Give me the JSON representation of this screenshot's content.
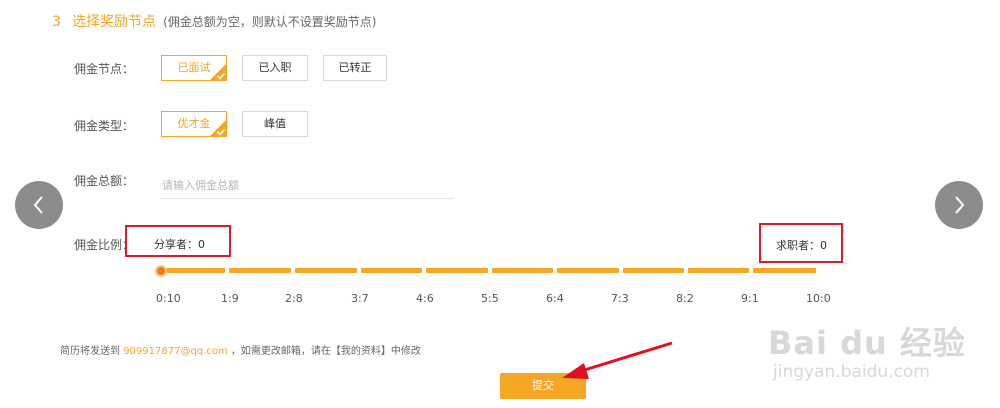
{
  "section": {
    "number": "3",
    "title": "选择奖励节点",
    "note": "(佣金总额为空，则默认不设置奖励节点)"
  },
  "commission_node": {
    "label": "佣金节点：",
    "options": [
      "已面试",
      "已入职",
      "已转正"
    ],
    "selected": "已面试"
  },
  "commission_type": {
    "label": "佣金类型：",
    "options": [
      "优才金",
      "峰值"
    ],
    "selected": "优才金"
  },
  "commission_total": {
    "label": "佣金总额：",
    "placeholder": "请输入佣金总额",
    "value": ""
  },
  "commission_ratio": {
    "label": "佣金比例：",
    "sharer": "分享者：0",
    "seeker": "求职者：0",
    "ticks": [
      "0:10",
      "1:9",
      "2:8",
      "3:7",
      "4:6",
      "5:5",
      "6:4",
      "7:3",
      "8:2",
      "9:1",
      "10:0"
    ],
    "selected": "0:10"
  },
  "footer": {
    "prefix": "简历将发送到",
    "email": "909917877@qq.com",
    "suffix": "，如需更改邮箱，请在【我的资料】中修改"
  },
  "submit_label": "提交",
  "watermark": {
    "main": "Bai du 经验",
    "sub": "jingyan.baidu.com"
  },
  "colors": {
    "accent": "#f5a623",
    "highlight_box": "#d71e2b",
    "nav": "#8c8c8c"
  },
  "icons": {
    "prev": "chevron-left-icon",
    "next": "chevron-right-icon",
    "selected_mark": "check-icon",
    "annotation": "red-arrow-icon"
  }
}
